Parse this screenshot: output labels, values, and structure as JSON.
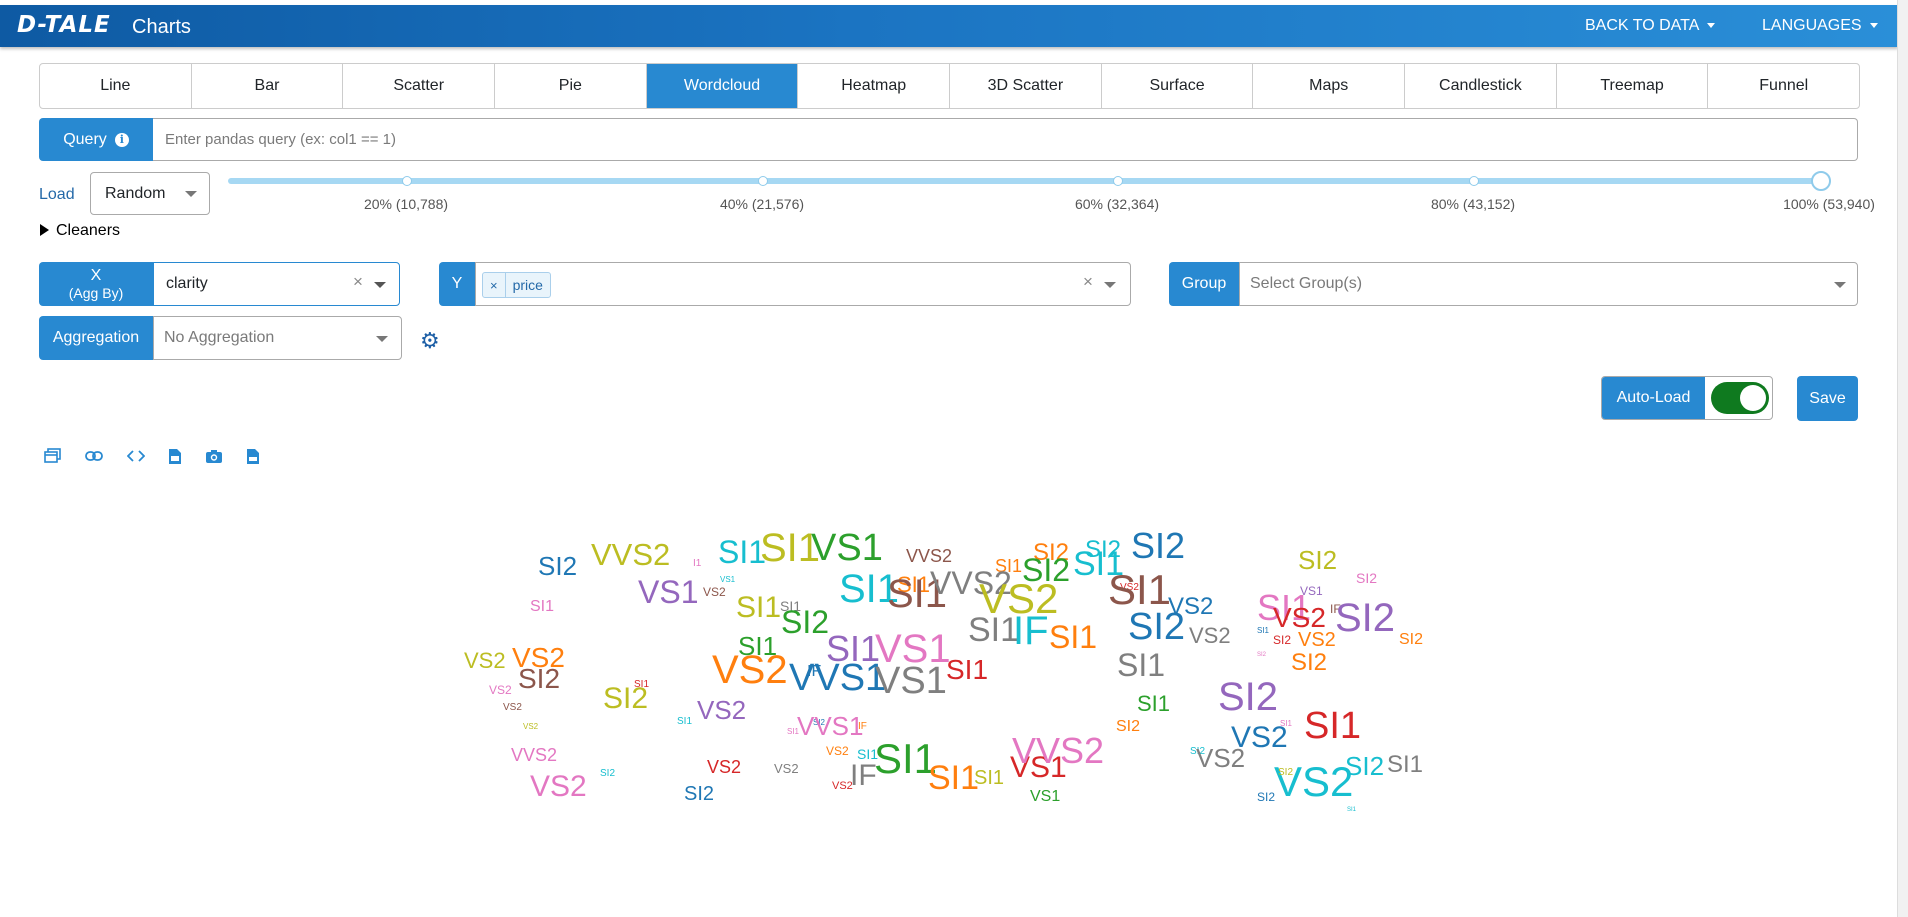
{
  "header": {
    "logo": "D-TALE",
    "title": "Charts",
    "back_to_data": "BACK TO DATA",
    "languages": "LANGUAGES"
  },
  "tabs": [
    "Line",
    "Bar",
    "Scatter",
    "Pie",
    "Wordcloud",
    "Heatmap",
    "3D Scatter",
    "Surface",
    "Maps",
    "Candlestick",
    "Treemap",
    "Funnel"
  ],
  "active_tab": "Wordcloud",
  "query": {
    "label": "Query",
    "placeholder": "Enter pandas query (ex: col1 == 1)"
  },
  "load": {
    "label": "Load",
    "value": "Random",
    "marks": [
      "20% (10,788)",
      "40% (21,576)",
      "60% (32,364)",
      "80% (43,152)",
      "100% (53,940)"
    ],
    "selected_fraction": 1.0
  },
  "cleaners": {
    "label": "Cleaners"
  },
  "x": {
    "label_line1": "X",
    "label_line2": "(Agg By)",
    "value": "clarity"
  },
  "y": {
    "label": "Y",
    "tag_remove": "×",
    "tag": "price"
  },
  "group": {
    "label": "Group",
    "placeholder": "Select Group(s)"
  },
  "aggregation": {
    "label": "Aggregation",
    "placeholder": "No Aggregation"
  },
  "autoload": {
    "label": "Auto-Load",
    "on": true
  },
  "save_label": "Save",
  "toolbar_icons": [
    "popup-icon",
    "link-icon",
    "code-icon",
    "export-icon",
    "camera-icon",
    "csv-icon"
  ],
  "wordcloud": {
    "words": [
      {
        "t": "SI2",
        "c": "#1f77b4",
        "s": 26
      },
      {
        "t": "VVS2",
        "c": "#bcbd22",
        "s": 31
      },
      {
        "t": "I1",
        "c": "#e377c2",
        "s": 10
      },
      {
        "t": "SI1",
        "c": "#17becf",
        "s": 32
      },
      {
        "t": "SI1",
        "c": "#bcbd22",
        "s": 40
      },
      {
        "t": "VS1",
        "c": "#2ca02c",
        "s": 38
      },
      {
        "t": "VVS2",
        "c": "#8c564b",
        "s": 18
      },
      {
        "t": "SI1",
        "c": "#ff7f0e",
        "s": 18
      },
      {
        "t": "SI2",
        "c": "#ff7f0e",
        "s": 24
      },
      {
        "t": "SI2",
        "c": "#17becf",
        "s": 24
      },
      {
        "t": "SI2",
        "c": "#1f77b4",
        "s": 36
      },
      {
        "t": "VS1",
        "c": "#17becf",
        "s": 8
      },
      {
        "t": "VS2",
        "c": "#8c564b",
        "s": 12
      },
      {
        "t": "SI1",
        "c": "#e377c2",
        "s": 16
      },
      {
        "t": "VS1",
        "c": "#9467bd",
        "s": 32
      },
      {
        "t": "SI1",
        "c": "#bcbd22",
        "s": 30
      },
      {
        "t": "SI1",
        "c": "#7f7f7f",
        "s": 14
      },
      {
        "t": "SI1",
        "c": "#17becf",
        "s": 40
      },
      {
        "t": "SI1",
        "c": "#ff7f0e",
        "s": 22
      },
      {
        "t": "SI1",
        "c": "#8c564b",
        "s": 40
      },
      {
        "t": "VVS2",
        "c": "#7f7f7f",
        "s": 32
      },
      {
        "t": "VS2",
        "c": "#bcbd22",
        "s": 42
      },
      {
        "t": "SI2",
        "c": "#2ca02c",
        "s": 32
      },
      {
        "t": "SI1",
        "c": "#17becf",
        "s": 34
      },
      {
        "t": "VS2",
        "c": "#d62728",
        "s": 10
      },
      {
        "t": "SI1",
        "c": "#8c564b",
        "s": 42
      },
      {
        "t": "VS2",
        "c": "#1f77b4",
        "s": 24
      },
      {
        "t": "SI2",
        "c": "#2ca02c",
        "s": 32
      },
      {
        "t": "SI1",
        "c": "#7f7f7f",
        "s": 34
      },
      {
        "t": "IF",
        "c": "#17becf",
        "s": 40
      },
      {
        "t": "SI1",
        "c": "#ff7f0e",
        "s": 32
      },
      {
        "t": "SI2",
        "c": "#1f77b4",
        "s": 38
      },
      {
        "t": "VS2",
        "c": "#7f7f7f",
        "s": 22
      },
      {
        "t": "SI1",
        "c": "#2ca02c",
        "s": 26
      },
      {
        "t": "VS2",
        "c": "#bcbd22",
        "s": 22
      },
      {
        "t": "VS2",
        "c": "#ff7f0e",
        "s": 28
      },
      {
        "t": "SI2",
        "c": "#8c564b",
        "s": 28
      },
      {
        "t": "SI1",
        "c": "#d62728",
        "s": 10
      },
      {
        "t": "VS2",
        "c": "#e377c2",
        "s": 12
      },
      {
        "t": "VS2",
        "c": "#8c564b",
        "s": 10
      },
      {
        "t": "VS2",
        "c": "#bcbd22",
        "s": 8
      },
      {
        "t": "VS2",
        "c": "#ff7f0e",
        "s": 40
      },
      {
        "t": "IF",
        "c": "#1f77b4",
        "s": 16
      },
      {
        "t": "SI1",
        "c": "#9467bd",
        "s": 36
      },
      {
        "t": "VS1",
        "c": "#e377c2",
        "s": 40
      },
      {
        "t": "VVS1",
        "c": "#1f77b4",
        "s": 38
      },
      {
        "t": "VS1",
        "c": "#7f7f7f",
        "s": 38
      },
      {
        "t": "SI1",
        "c": "#d62728",
        "s": 28
      },
      {
        "t": "SI1",
        "c": "#7f7f7f",
        "s": 32
      },
      {
        "t": "SI2",
        "c": "#bcbd22",
        "s": 30
      },
      {
        "t": "SI1",
        "c": "#17becf",
        "s": 10
      },
      {
        "t": "VS2",
        "c": "#9467bd",
        "s": 26
      },
      {
        "t": "SI2",
        "c": "#1f77b4",
        "s": 8
      },
      {
        "t": "SI1",
        "c": "#e377c2",
        "s": 8
      },
      {
        "t": "VVS1",
        "c": "#e377c2",
        "s": 26
      },
      {
        "t": "IF",
        "c": "#ff7f0e",
        "s": 10
      },
      {
        "t": "SI1",
        "c": "#2ca02c",
        "s": 22
      },
      {
        "t": "SI2",
        "c": "#ff7f0e",
        "s": 16
      },
      {
        "t": "SI2",
        "c": "#9467bd",
        "s": 40
      },
      {
        "t": "SI1",
        "c": "#e377c2",
        "s": 8
      },
      {
        "t": "VS2",
        "c": "#1f77b4",
        "s": 30
      },
      {
        "t": "SI1",
        "c": "#d62728",
        "s": 38
      },
      {
        "t": "SI2",
        "c": "#17becf",
        "s": 10
      },
      {
        "t": "VS2",
        "c": "#7f7f7f",
        "s": 26
      },
      {
        "t": "VVS2",
        "c": "#e377c2",
        "s": 18
      },
      {
        "t": "SI2",
        "c": "#17becf",
        "s": 10
      },
      {
        "t": "VS2",
        "c": "#d62728",
        "s": 18
      },
      {
        "t": "VS2",
        "c": "#7f7f7f",
        "s": 13
      },
      {
        "t": "VS2",
        "c": "#ff7f0e",
        "s": 12
      },
      {
        "t": "SI1",
        "c": "#17becf",
        "s": 14
      },
      {
        "t": "VS2",
        "c": "#d62728",
        "s": 11
      },
      {
        "t": "IF",
        "c": "#7f7f7f",
        "s": 30
      },
      {
        "t": "SI1",
        "c": "#2ca02c",
        "s": 42
      },
      {
        "t": "SI1",
        "c": "#ff7f0e",
        "s": 34
      },
      {
        "t": "SI1",
        "c": "#bcbd22",
        "s": 20
      },
      {
        "t": "VS1",
        "c": "#d62728",
        "s": 30
      },
      {
        "t": "VS1",
        "c": "#2ca02c",
        "s": 16
      },
      {
        "t": "VVS2",
        "c": "#e377c2",
        "s": 36
      },
      {
        "t": "VS2",
        "c": "#e377c2",
        "s": 30
      },
      {
        "t": "SI2",
        "c": "#1f77b4",
        "s": 20
      },
      {
        "t": "SI2",
        "c": "#bcbd22",
        "s": 26
      },
      {
        "t": "SI2",
        "c": "#e377c2",
        "s": 14
      },
      {
        "t": "VS1",
        "c": "#9467bd",
        "s": 12
      },
      {
        "t": "SI1",
        "c": "#e377c2",
        "s": 36
      },
      {
        "t": "IF",
        "c": "#8c564b",
        "s": 12
      },
      {
        "t": "VS2",
        "c": "#d62728",
        "s": 28
      },
      {
        "t": "SI2",
        "c": "#9467bd",
        "s": 40
      },
      {
        "t": "SI2",
        "c": "#ff7f0e",
        "s": 16
      },
      {
        "t": "SI1",
        "c": "#1f77b4",
        "s": 8
      },
      {
        "t": "SI2",
        "c": "#d62728",
        "s": 12
      },
      {
        "t": "VS2",
        "c": "#ff7f0e",
        "s": 20
      },
      {
        "t": "SI2",
        "c": "#e377c2",
        "s": 6
      },
      {
        "t": "SI2",
        "c": "#ff7f0e",
        "s": 24
      },
      {
        "t": "SI2",
        "c": "#1f77b4",
        "s": 12
      },
      {
        "t": "VS2",
        "c": "#17becf",
        "s": 42
      },
      {
        "t": "SI2",
        "c": "#17becf",
        "s": 26
      },
      {
        "t": "SI1",
        "c": "#7f7f7f",
        "s": 24
      },
      {
        "t": "SI2",
        "c": "#bcbd22",
        "s": 10
      },
      {
        "t": "SI1",
        "c": "#17becf",
        "s": 6
      }
    ]
  }
}
